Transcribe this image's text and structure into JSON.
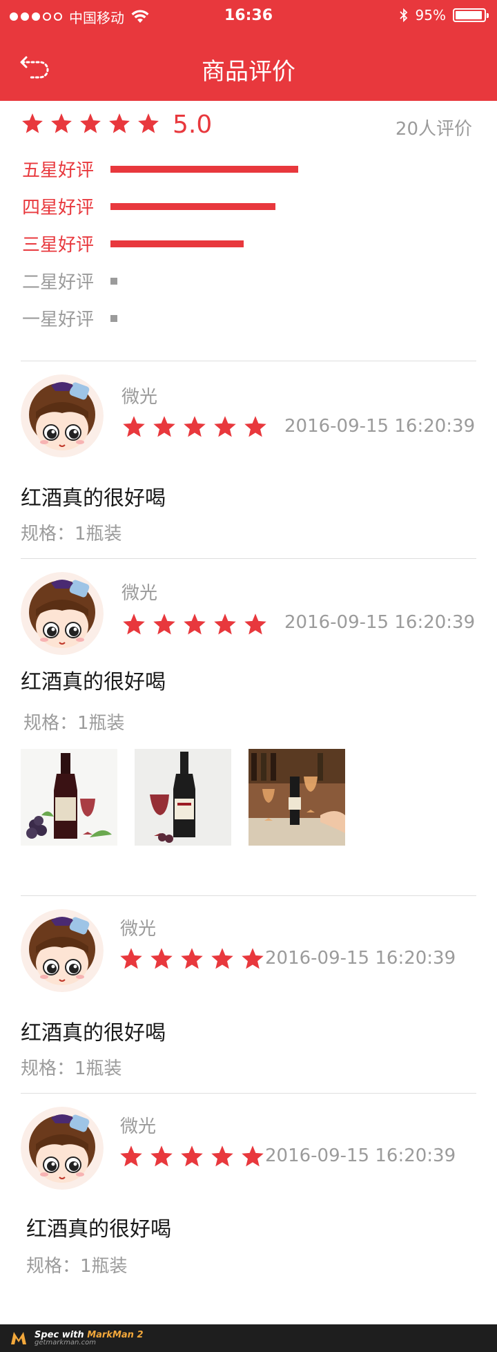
{
  "status_bar": {
    "carrier": "中国移动",
    "time": "16:36",
    "battery": "95%",
    "battery_level": 0.95
  },
  "nav": {
    "title": "商品评价",
    "back_icon": "back-arrow-icon"
  },
  "summary": {
    "score": "5.0",
    "rating_count": "20人评价",
    "stars": 5
  },
  "distribution": [
    {
      "label": "五星好评",
      "fraction": 1.0,
      "color": "#e8383d"
    },
    {
      "label": "四星好评",
      "fraction": 0.88,
      "color": "#e8383d"
    },
    {
      "label": "三星好评",
      "fraction": 0.71,
      "color": "#e8383d"
    },
    {
      "label": "二星好评",
      "fraction": 0.03,
      "color": "#9b9b9b"
    },
    {
      "label": "一星好评",
      "fraction": 0.03,
      "color": "#9b9b9b"
    }
  ],
  "reviews": [
    {
      "user": "微光",
      "stars": 5,
      "time": "2016-09-15 16:20:39",
      "text": "红酒真的很好喝",
      "spec": "规格：1瓶装",
      "photos": []
    },
    {
      "user": "微光",
      "stars": 5,
      "time": "2016-09-15 16:20:39",
      "text": "红酒真的很好喝",
      "spec": "规格：1瓶装",
      "photos": [
        "wine-bottle-grapes-photo",
        "wine-bottle-glass-photo",
        "wine-bar-photo"
      ]
    },
    {
      "user": "微光",
      "stars": 5,
      "time": "2016-09-15 16:20:39",
      "text": "红酒真的很好喝",
      "spec": "规格：1瓶装",
      "photos": []
    },
    {
      "user": "微光",
      "stars": 5,
      "time": "2016-09-15 16:20:39",
      "text": "红酒真的很好喝",
      "spec": "规格：1瓶装",
      "photos": []
    }
  ],
  "footer": {
    "spec_with": "Spec with",
    "brand": "MarkMan 2",
    "site": "getmarkman.com"
  },
  "colors": {
    "accent": "#e8383d",
    "grey_text": "#9b9b9b",
    "body_text": "#191919"
  }
}
